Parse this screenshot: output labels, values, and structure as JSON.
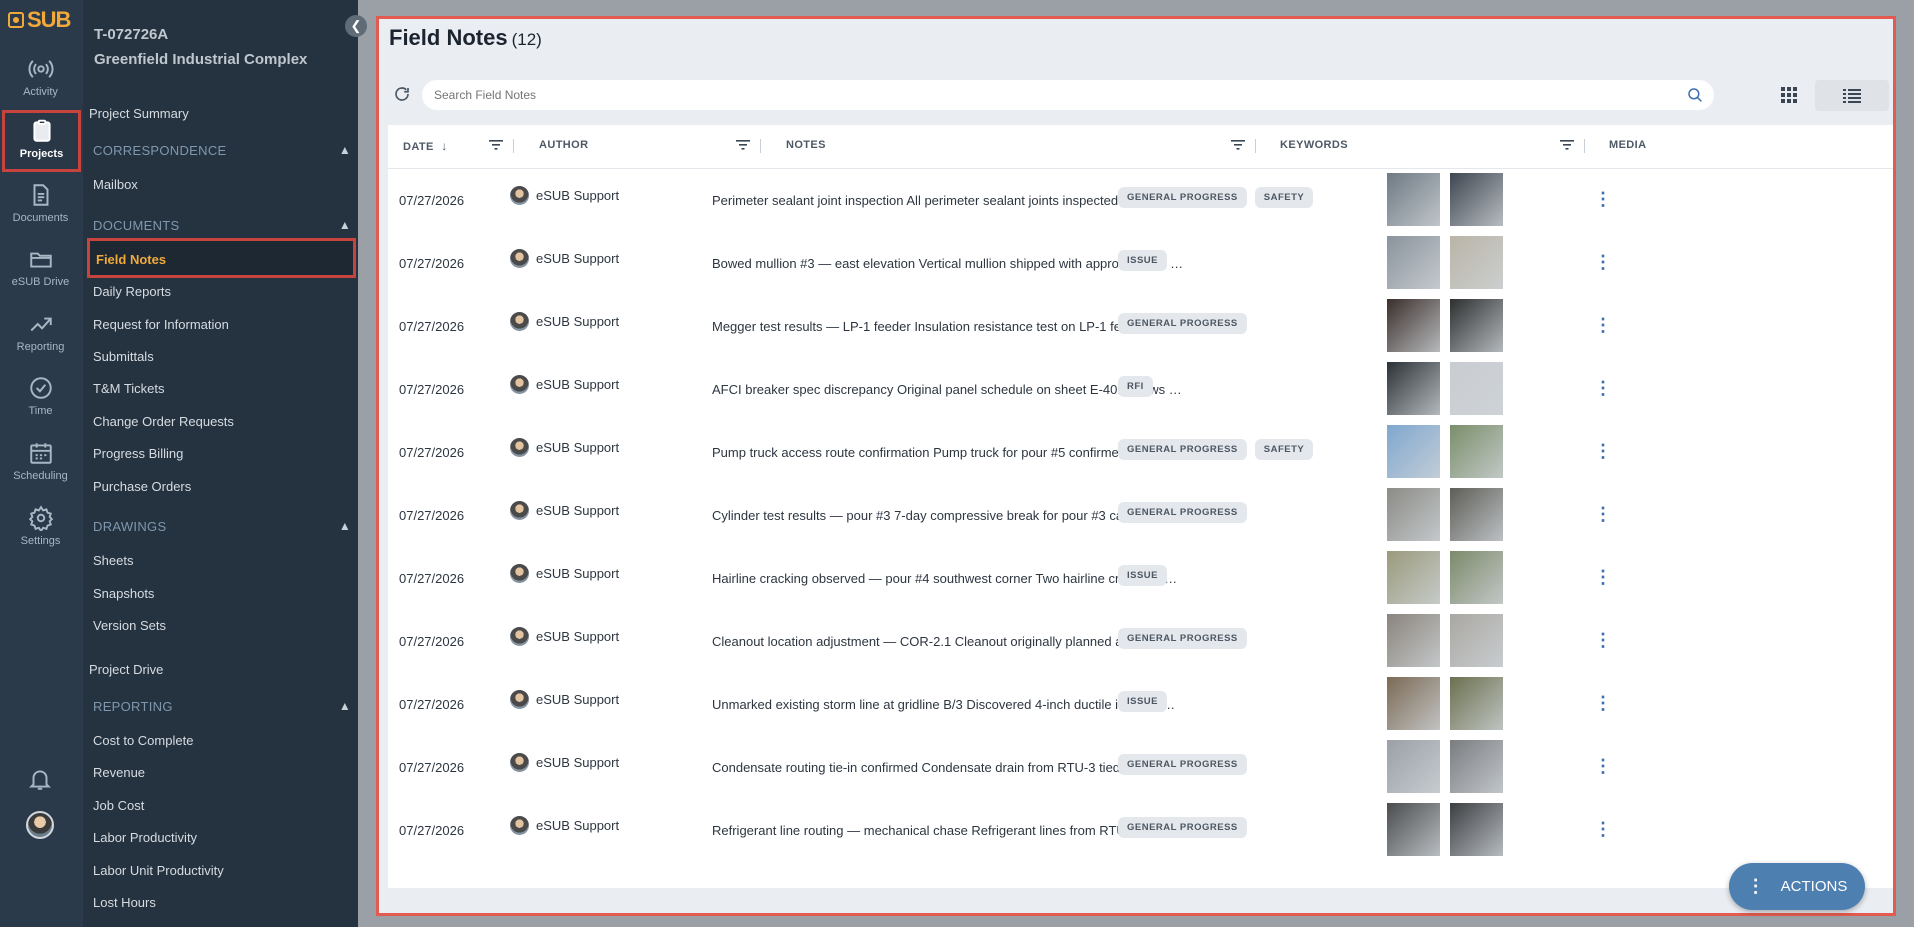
{
  "app": {
    "logo_text": "SUB"
  },
  "rail": {
    "items": [
      {
        "label": "Activity",
        "icon": "activity-icon"
      },
      {
        "label": "Projects",
        "icon": "clipboard-icon"
      },
      {
        "label": "Documents",
        "icon": "document-icon"
      },
      {
        "label": "eSUB Drive",
        "icon": "folder-icon"
      },
      {
        "label": "Reporting",
        "icon": "chart-line-icon"
      },
      {
        "label": "Time",
        "icon": "clock-icon"
      },
      {
        "label": "Scheduling",
        "icon": "calendar-icon"
      },
      {
        "label": "Settings",
        "icon": "gear-icon"
      }
    ]
  },
  "project": {
    "id": "T-072726A",
    "name": "Greenfield Industrial Complex"
  },
  "sidebar": {
    "project_summary": "Project Summary",
    "correspondence": {
      "heading": "CORRESPONDENCE",
      "items": [
        "Mailbox"
      ]
    },
    "documents": {
      "heading": "DOCUMENTS",
      "items": [
        "Field Notes",
        "Daily Reports",
        "Request for Information",
        "Submittals",
        "T&M Tickets",
        "Change Order Requests",
        "Progress Billing",
        "Purchase Orders"
      ]
    },
    "drawings": {
      "heading": "DRAWINGS",
      "items": [
        "Sheets",
        "Snapshots",
        "Version Sets"
      ]
    },
    "project_drive": "Project Drive",
    "reporting": {
      "heading": "REPORTING",
      "items": [
        "Cost to Complete",
        "Revenue",
        "Job Cost",
        "Labor Productivity",
        "Labor Unit Productivity",
        "Lost Hours"
      ]
    }
  },
  "page": {
    "title": "Field Notes",
    "count": "(12)"
  },
  "search": {
    "placeholder": "Search Field Notes"
  },
  "table": {
    "headers": {
      "date": "DATE",
      "author": "AUTHOR",
      "notes": "NOTES",
      "keywords": "KEYWORDS",
      "media": "MEDIA"
    },
    "rows": [
      {
        "date": "07/27/2026",
        "author": "eSUB Support",
        "notes": "Perimeter sealant joint inspection All perimeter sealant joints inspected after 24…",
        "tags": [
          "GENERAL PROGRESS",
          "SAFETY"
        ],
        "media": [
          "#6f7a84",
          "#3e4650"
        ]
      },
      {
        "date": "07/27/2026",
        "author": "eSUB Support",
        "notes": "Bowed mullion #3 — east elevation Vertical mullion shipped with approximately …",
        "tags": [
          "ISSUE"
        ],
        "media": [
          "#8a939c",
          "#b9b4a6"
        ]
      },
      {
        "date": "07/27/2026",
        "author": "eSUB Support",
        "notes": "Megger test results — LP-1 feeder Insulation resistance test on LP-1 feeder sho…",
        "tags": [
          "GENERAL PROGRESS"
        ],
        "media": [
          "#3a2f2c",
          "#2d2f30"
        ]
      },
      {
        "date": "07/27/2026",
        "author": "eSUB Support",
        "notes": "AFCI breaker spec discrepancy Original panel schedule on sheet E-401 shows …",
        "tags": [
          "RFI"
        ],
        "media": [
          "#2c3136",
          "#c9ccd1"
        ]
      },
      {
        "date": "07/27/2026",
        "author": "eSUB Support",
        "notes": "Pump truck access route confirmation Pump truck for pour #5 confirmed acces…",
        "tags": [
          "GENERAL PROGRESS",
          "SAFETY"
        ],
        "media": [
          "#7fa7cf",
          "#7a8e6a"
        ]
      },
      {
        "date": "07/27/2026",
        "author": "eSUB Support",
        "notes": "Cylinder test results — pour #3 7-day compressive break for pour #3 came bac…",
        "tags": [
          "GENERAL PROGRESS"
        ],
        "media": [
          "#8b8b86",
          "#5e5e58"
        ]
      },
      {
        "date": "07/27/2026",
        "author": "eSUB Support",
        "notes": "Hairline cracking observed — pour #4 southwest corner Two hairline cracks ob…",
        "tags": [
          "ISSUE"
        ],
        "media": [
          "#9a9a7c",
          "#7c8a6a"
        ]
      },
      {
        "date": "07/27/2026",
        "author": "eSUB Support",
        "notes": "Cleanout location adjustment — COR-2.1 Cleanout originally planned at gridline…",
        "tags": [
          "GENERAL PROGRESS"
        ],
        "media": [
          "#8a847c",
          "#a9a7a2"
        ]
      },
      {
        "date": "07/27/2026",
        "author": "eSUB Support",
        "notes": "Unmarked existing storm line at gridline B/3 Discovered 4-inch ductile iron stor…",
        "tags": [
          "ISSUE"
        ],
        "media": [
          "#7b6a55",
          "#6b7050"
        ]
      },
      {
        "date": "07/27/2026",
        "author": "eSUB Support",
        "notes": "Condensate routing tie-in confirmed Condensate drain from RTU-3 tied into ro…",
        "tags": [
          "GENERAL PROGRESS"
        ],
        "media": [
          "#9aa0a6",
          "#7a7d80"
        ]
      },
      {
        "date": "07/27/2026",
        "author": "eSUB Support",
        "notes": "Refrigerant line routing — mechanical chase Refrigerant lines from RTU-3 route…",
        "tags": [
          "GENERAL PROGRESS"
        ],
        "media": [
          "#4a4c4e",
          "#3c3f42"
        ]
      }
    ]
  },
  "actions": {
    "label": "ACTIONS"
  },
  "colors": {
    "accent": "#f2a93b",
    "highlight": "#e35a50",
    "action": "#4d7fb1"
  }
}
